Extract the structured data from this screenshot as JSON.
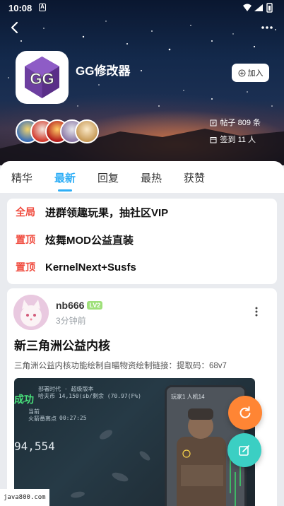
{
  "status_bar": {
    "time": "10:08",
    "badge": "A"
  },
  "group": {
    "name": "GG修改器",
    "join_label": "加入",
    "posts_label": "帖子 809 条",
    "signin_label": "签到 11 人"
  },
  "tabs": [
    {
      "label": "精华"
    },
    {
      "label": "最新"
    },
    {
      "label": "回复"
    },
    {
      "label": "最热"
    },
    {
      "label": "获赞"
    }
  ],
  "active_tab": "最新",
  "pinned": [
    {
      "tag": "全局",
      "text": "进群领趣玩果，抽社区VIP"
    },
    {
      "tag": "置顶",
      "text": "炫舞MOD公益直装"
    },
    {
      "tag": "置顶",
      "text": "KernelNext+Susfs"
    }
  ],
  "post": {
    "username": "nb666",
    "level": "LV2",
    "time": "3分钟前",
    "title": "新三角洲公益内核",
    "description": "三角洲公益内核功能绘制自瞄物资绘制链接：提取码：68v7",
    "image_overlay": {
      "cheng": "成功",
      "hud_title": "部署时代 · 超级版本",
      "hud_sub": "哈夫币 14,150(sb/剩余 (70.97(F%)",
      "big_number": "94,554",
      "label_1": "当前",
      "label_2": "火箭番离点",
      "value_1": "00:27:25",
      "phone_label": "玩家1 人机14"
    }
  },
  "watermark": "java800.com",
  "colors": {
    "accent": "#2eaef6",
    "pin_tag": "#f04a3d",
    "fab_refresh": "#ff8534",
    "fab_edit": "#3bcfc3"
  }
}
